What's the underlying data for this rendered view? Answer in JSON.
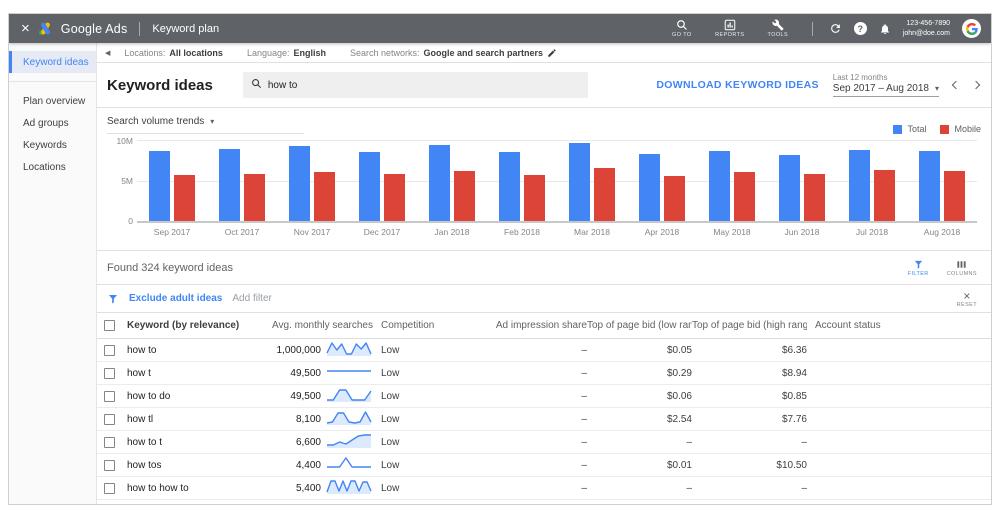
{
  "topbar": {
    "close_label": "×",
    "product": "Google Ads",
    "page": "Keyword plan",
    "nav": [
      {
        "label": "GO TO",
        "icon": "search-icon"
      },
      {
        "label": "REPORTS",
        "icon": "reports-chart-icon"
      },
      {
        "label": "TOOLS",
        "icon": "wrench-icon"
      }
    ],
    "account": {
      "phone": "123-456-7890",
      "email": "john@doe.com"
    }
  },
  "context_bar": {
    "locations_label": "Locations:",
    "locations_value": "All locations",
    "language_label": "Language:",
    "language_value": "English",
    "networks_label": "Search networks:",
    "networks_value": "Google and search partners"
  },
  "sidebar": {
    "items": [
      {
        "label": "Keyword ideas",
        "active": true
      },
      {
        "label": "Plan overview",
        "active": false
      },
      {
        "label": "Ad groups",
        "active": false
      },
      {
        "label": "Keywords",
        "active": false
      },
      {
        "label": "Locations",
        "active": false
      }
    ]
  },
  "header": {
    "title": "Keyword ideas",
    "search_value": "how to",
    "download_label": "DOWNLOAD KEYWORD IDEAS",
    "range_caption": "Last 12 months",
    "range_value": "Sep 2017 – Aug 2018"
  },
  "chart_data": {
    "type": "bar",
    "title": "Search volume trends",
    "categories": [
      "Sep 2017",
      "Oct 2017",
      "Nov 2017",
      "Dec 2017",
      "Jan 2018",
      "Feb 2018",
      "Mar 2018",
      "Apr 2018",
      "May 2018",
      "Jun 2018",
      "Jul 2018",
      "Aug 2018"
    ],
    "series": [
      {
        "name": "Total",
        "color": "#4285f4",
        "values": [
          8.6,
          8.9,
          9.2,
          8.5,
          9.4,
          8.5,
          9.6,
          8.3,
          8.6,
          8.1,
          8.8,
          8.6
        ]
      },
      {
        "name": "Mobile",
        "color": "#db4437",
        "values": [
          5.7,
          5.8,
          6.0,
          5.8,
          6.2,
          5.7,
          6.6,
          5.6,
          6.0,
          5.8,
          6.3,
          6.2
        ]
      }
    ],
    "unit": "M searches",
    "ylim": [
      0,
      10
    ],
    "y_ticks": [
      "10M",
      "5M",
      "0"
    ],
    "grid": true,
    "legend_position": "top-right"
  },
  "results": {
    "found_text": "Found 324 keyword ideas",
    "filter_button": "FILTER",
    "columns_button": "COLUMNS",
    "exclude_link": "Exclude adult ideas",
    "add_filter": "Add filter",
    "reset_label": "RESET"
  },
  "table": {
    "headers": [
      "Keyword (by relevance)",
      "Avg. monthly searches",
      "Competition",
      "Ad impression share",
      "Top of page bid (low range)",
      "Top of page bid (high range)",
      "Account status"
    ],
    "rows": [
      {
        "keyword": "how to",
        "searches": "1,000,000",
        "competition": "Low",
        "impression_share": "–",
        "low_bid": "$0.05",
        "high_bid": "$6.36",
        "account_status": "",
        "trend": [
          13,
          3,
          10,
          4,
          14,
          14,
          4,
          9,
          3,
          14
        ],
        "trend_fill": true
      },
      {
        "keyword": "how t",
        "searches": "49,500",
        "competition": "Low",
        "impression_share": "–",
        "low_bid": "$0.29",
        "high_bid": "$8.94",
        "account_status": "",
        "trend": [
          8,
          8,
          8,
          8,
          8,
          8,
          8,
          8
        ],
        "trend_fill": false
      },
      {
        "keyword": "how to do",
        "searches": "49,500",
        "competition": "Low",
        "impression_share": "–",
        "low_bid": "$0.06",
        "high_bid": "$0.85",
        "account_status": "",
        "trend": [
          14,
          14,
          4,
          4,
          14,
          14,
          14,
          5
        ],
        "trend_fill": true
      },
      {
        "keyword": "how tl",
        "searches": "8,100",
        "competition": "Low",
        "impression_share": "–",
        "low_bid": "$2.54",
        "high_bid": "$7.76",
        "account_status": "",
        "trend": [
          14,
          13,
          4,
          4,
          13,
          14,
          13,
          3,
          13
        ],
        "trend_fill": true
      },
      {
        "keyword": "how to t",
        "searches": "6,600",
        "competition": "Low",
        "impression_share": "–",
        "low_bid": "–",
        "high_bid": "–",
        "account_status": "",
        "trend": [
          13,
          13,
          10,
          12,
          8,
          4,
          3,
          3
        ],
        "trend_fill": true
      },
      {
        "keyword": "how tos",
        "searches": "4,400",
        "competition": "Low",
        "impression_share": "–",
        "low_bid": "$0.01",
        "high_bid": "$10.50",
        "account_status": "",
        "trend": [
          12,
          12,
          12,
          3,
          12,
          12,
          12,
          12
        ],
        "trend_fill": false
      },
      {
        "keyword": "how to how to",
        "searches": "5,400",
        "competition": "Low",
        "impression_share": "–",
        "low_bid": "–",
        "high_bid": "–",
        "account_status": "",
        "trend": [
          14,
          3,
          3,
          13,
          3,
          13,
          3,
          3,
          13,
          4,
          4,
          13
        ],
        "trend_fill": true
      }
    ]
  }
}
